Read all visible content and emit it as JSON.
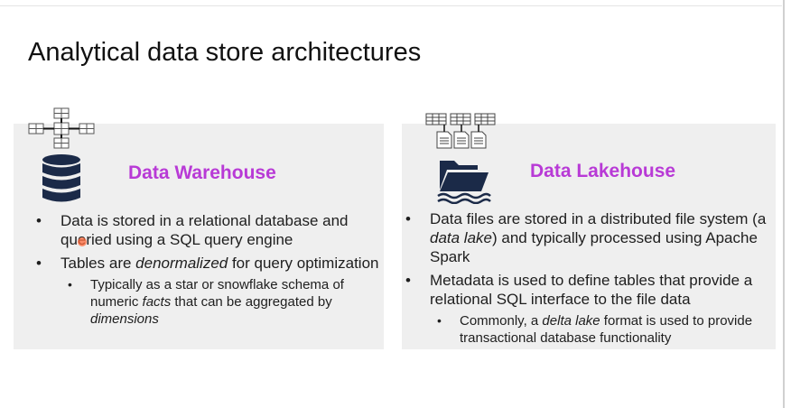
{
  "title": "Analytical data store architectures",
  "colors": {
    "accent": "#b83ad6",
    "panel_bg": "#efefef",
    "icon_dark": "#1b2a48"
  },
  "left": {
    "heading": "Data Warehouse",
    "icons": [
      "star-schema-icon",
      "database-cylinder-icon"
    ],
    "b1_pre": "Data is stored in a relational database and queried using a SQL query engine",
    "b2_pre": "Tables are ",
    "b2_em": "denormalized",
    "b2_post": " for query optimization",
    "sub_pre": "Typically as a star or snowflake schema of numeric ",
    "sub_em1": "facts",
    "sub_mid": " that can be aggregated by ",
    "sub_em2": "dimensions"
  },
  "right": {
    "heading": "Data Lakehouse",
    "icons": [
      "tables-files-icon",
      "folder-lake-icon"
    ],
    "b1_pre": "Data files are stored in a distributed file system (a ",
    "b1_em": "data lake",
    "b1_post": ") and typically processed using Apache Spark",
    "b2_text": "Metadata is used to define tables that provide a relational SQL interface to the file data",
    "sub_pre": "Commonly, a ",
    "sub_em": "delta lake",
    "sub_post": " format is used to provide transactional database functionality"
  }
}
